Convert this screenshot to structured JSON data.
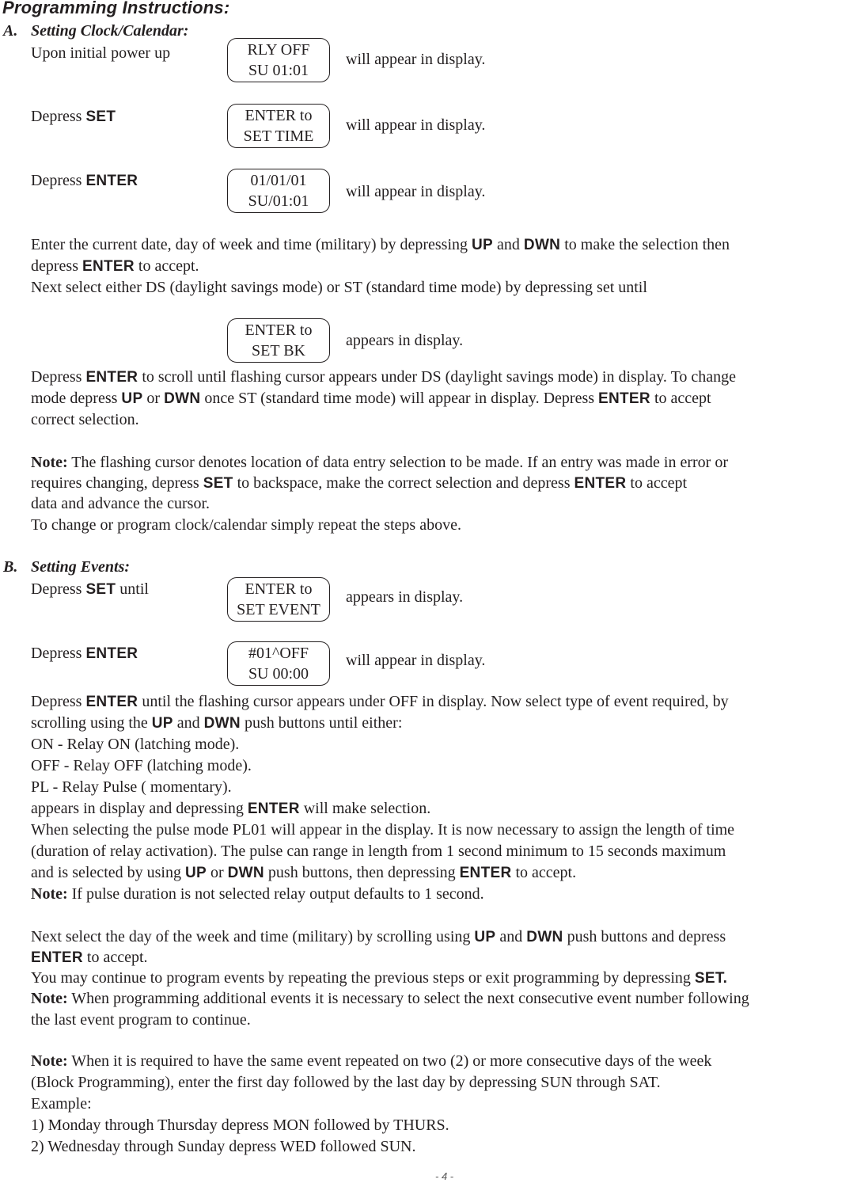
{
  "page": {
    "title": "Programming Instructions:",
    "page_number": "- 4 -"
  },
  "section_a": {
    "label": "A.",
    "heading": "Setting Clock/Calendar:",
    "step1": {
      "text": "Upon initial power up",
      "display": [
        "RLY OFF",
        "SU 01:01"
      ],
      "after": "will appear in display."
    },
    "step2": {
      "prefix": "Depress ",
      "key": "SET",
      "display": [
        "ENTER to",
        "SET TIME"
      ],
      "after": "will appear in display."
    },
    "step3": {
      "prefix": "Depress ",
      "key": "ENTER",
      "display": [
        "01/01/01",
        "SU/01:01"
      ],
      "after": "will appear in display."
    },
    "p1": {
      "l1a": "Enter the current date, day of week and time (military) by depressing ",
      "k1": "UP",
      "l1b": " and ",
      "k2": "DWN",
      "l1c": " to make the selection then",
      "l2a": "depress ",
      "k3": "ENTER",
      "l2b": " to accept.",
      "l3": "Next select either DS (daylight savings mode) or ST (standard time mode) by depressing set until"
    },
    "step4": {
      "display": [
        "ENTER to",
        "SET BK"
      ],
      "after": "appears in display."
    },
    "p2": {
      "l1a": "Depress ",
      "k1": "ENTER",
      "l1b": " to scroll until flashing cursor appears under DS (daylight savings mode) in display. To change",
      "l2a": "mode depress ",
      "k2": "UP",
      "l2b": " or ",
      "k3": "DWN",
      "l2c": " once ST (standard time mode) will appear in display. Depress ",
      "k4": "ENTER",
      "l2d": " to accept",
      "l3": "correct selection."
    },
    "note": {
      "label": "Note:",
      "l1": " The flashing cursor denotes location of data entry selection to be made. If an entry was made in error or",
      "l2a": "requires changing, depress ",
      "k1": "SET",
      "l2b": " to backspace, make the correct selection and depress ",
      "k2": "ENTER",
      "l2c": " to accept",
      "l3": "data and advance the cursor.",
      "l4": "To change or program clock/calendar simply repeat the steps above."
    }
  },
  "section_b": {
    "label": "B.",
    "heading": "Setting Events:",
    "step1": {
      "prefix": "Depress ",
      "key": "SET",
      "suffix": " until",
      "display": [
        "ENTER to",
        "SET EVENT"
      ],
      "after": "appears in display."
    },
    "step2": {
      "prefix": "Depress ",
      "key": "ENTER",
      "display": [
        "#01^OFF",
        "SU 00:00"
      ],
      "after": "will appear in display."
    },
    "p1": {
      "l1a": "Depress ",
      "k1": "ENTER",
      "l1b": " until the flashing cursor appears under OFF in display. Now select type of event required, by",
      "l2a": "scrolling using the ",
      "k2": "UP",
      "l2b": " and ",
      "k3": "DWN",
      "l2c": " push buttons until either:",
      "l3": "ON - Relay ON (latching mode).",
      "l4": "OFF - Relay OFF (latching mode).",
      "l5": "PL - Relay Pulse ( momentary).",
      "l6a": "appears in display and depressing ",
      "k4": "ENTER",
      "l6b": " will make selection.",
      "l7": "When selecting the pulse mode PL01 will appear in the display. It is now necessary to assign the length of time",
      "l8": "(duration of relay activation). The pulse can range in length from 1 second  minimum to 15 seconds  maximum",
      "l9a": "and is selected by using ",
      "k5": "UP",
      "l9b": " or ",
      "k6": "DWN",
      "l9c": " push buttons, then depressing ",
      "k7": "ENTER",
      "l9d": " to accept.",
      "note_label": "Note:",
      "l10": " If pulse duration is not selected relay output defaults to 1 second."
    },
    "p2": {
      "l1a": "Next select the day of the week and time (military) by scrolling using ",
      "k1": "UP",
      "l1b": " and ",
      "k2": "DWN",
      "l1c": " push buttons and depress",
      "k3": "ENTER",
      "l2b": " to accept.",
      "l3a": "You may continue to program events by repeating the previous steps or exit programming by depressing ",
      "k4": "SET.",
      "note_label": "Note:",
      "l4": " When programming additional events it is necessary to select the next consecutive event number following",
      "l5": "the last event program to continue."
    },
    "p3": {
      "note_label": "Note:",
      "l1": " When it is required to have the same event repeated on two (2) or more consecutive days of the week",
      "l2": "(Block Programming), enter the first day followed by the last day by depressing SUN through SAT.",
      "l3": "Example:",
      "l4": "1) Monday through Thursday depress MON followed by THURS.",
      "l5": "2) Wednesday through Sunday depress WED followed SUN."
    }
  }
}
